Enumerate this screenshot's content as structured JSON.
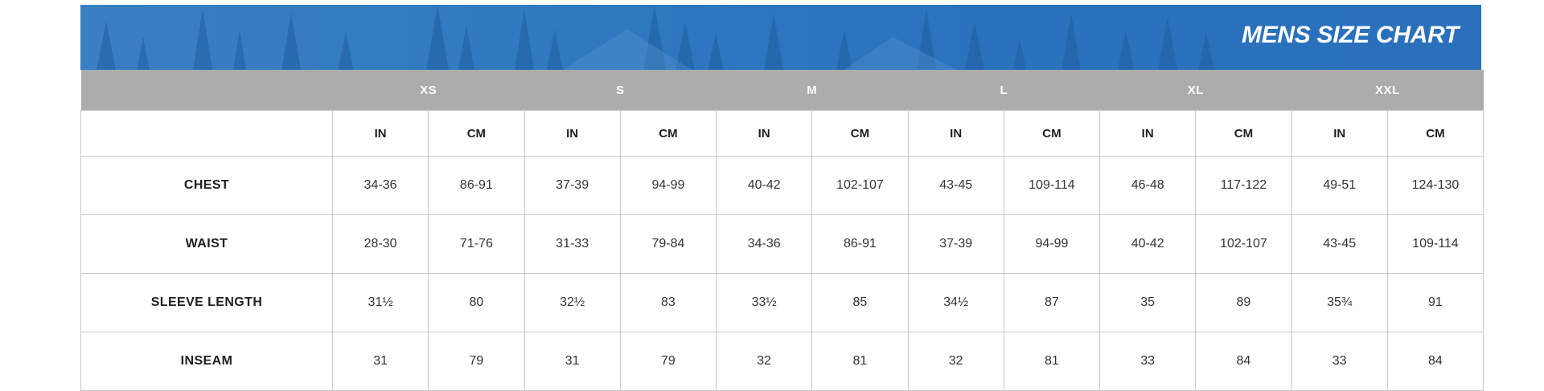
{
  "title": "MENS SIZE CHART",
  "sizes": [
    "XS",
    "S",
    "M",
    "L",
    "XL",
    "XXL"
  ],
  "units": [
    "IN",
    "CM"
  ],
  "rows": [
    {
      "label": "CHEST",
      "values": [
        "34-36",
        "86-91",
        "37-39",
        "94-99",
        "40-42",
        "102-107",
        "43-45",
        "109-114",
        "46-48",
        "117-122",
        "49-51",
        "124-130"
      ]
    },
    {
      "label": "WAIST",
      "values": [
        "28-30",
        "71-76",
        "31-33",
        "79-84",
        "34-36",
        "86-91",
        "37-39",
        "94-99",
        "40-42",
        "102-107",
        "43-45",
        "109-114"
      ]
    },
    {
      "label": "SLEEVE LENGTH",
      "values": [
        "31½",
        "80",
        "32½",
        "83",
        "33½",
        "85",
        "34½",
        "87",
        "35",
        "89",
        "35¾",
        "91"
      ]
    },
    {
      "label": "INSEAM",
      "values": [
        "31",
        "79",
        "31",
        "79",
        "32",
        "81",
        "32",
        "81",
        "33",
        "84",
        "33",
        "84"
      ]
    }
  ],
  "colors": {
    "banner": "#2f79c1",
    "size_header": "#acacac",
    "border": "#c9c9c9"
  }
}
